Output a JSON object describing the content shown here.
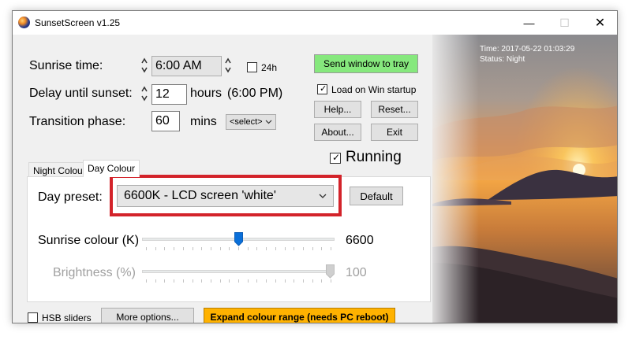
{
  "window": {
    "title": "SunsetScreen v1.25"
  },
  "status": {
    "time": "Time: 2017-05-22 01:03:29",
    "status": "Status: Night"
  },
  "sunrise": {
    "label": "Sunrise time:",
    "value": "6:00 AM",
    "h24_label": "24h",
    "h24_checked": false
  },
  "delay": {
    "label": "Delay until sunset:",
    "value": "12",
    "unit": "hours",
    "computed": "(6:00 PM)"
  },
  "transition": {
    "label": "Transition phase:",
    "value": "60",
    "unit": "mins",
    "select": "<select>"
  },
  "buttons": {
    "send_tray": "Send window to tray",
    "load_startup": "Load on Win startup",
    "load_startup_checked": true,
    "help": "Help...",
    "reset": "Reset...",
    "about": "About...",
    "exit": "Exit",
    "running": "Running",
    "running_checked": true
  },
  "tabs": [
    {
      "label": "Night Colour",
      "active": false
    },
    {
      "label": "Day Colour",
      "active": true
    }
  ],
  "day_colour": {
    "preset_label": "Day preset:",
    "preset_value": "6600K - LCD screen 'white'",
    "default_button": "Default",
    "sunrise_colour_label": "Sunrise colour (K)",
    "sunrise_colour_value": "6600",
    "sunrise_colour_fraction": 0.5,
    "brightness_label": "Brightness (%)",
    "brightness_value": "100",
    "brightness_fraction": 1.0
  },
  "footer": {
    "hsb_label": "HSB sliders",
    "hsb_checked": false,
    "more_options": "More options...",
    "expand_range": "Expand colour range (needs PC reboot)"
  },
  "colors": {
    "highlight": "#d3232a",
    "send_tray_bg": "#86e87d",
    "expand_bg": "#ffb200",
    "slider_thumb": "#0a6fd9"
  },
  "icons": [
    "app-icon",
    "minimize-icon",
    "maximize-icon",
    "close-icon",
    "spinner-arrows-icon",
    "chevron-down-icon",
    "checkmark-icon",
    "slider-thumb-icon"
  ]
}
